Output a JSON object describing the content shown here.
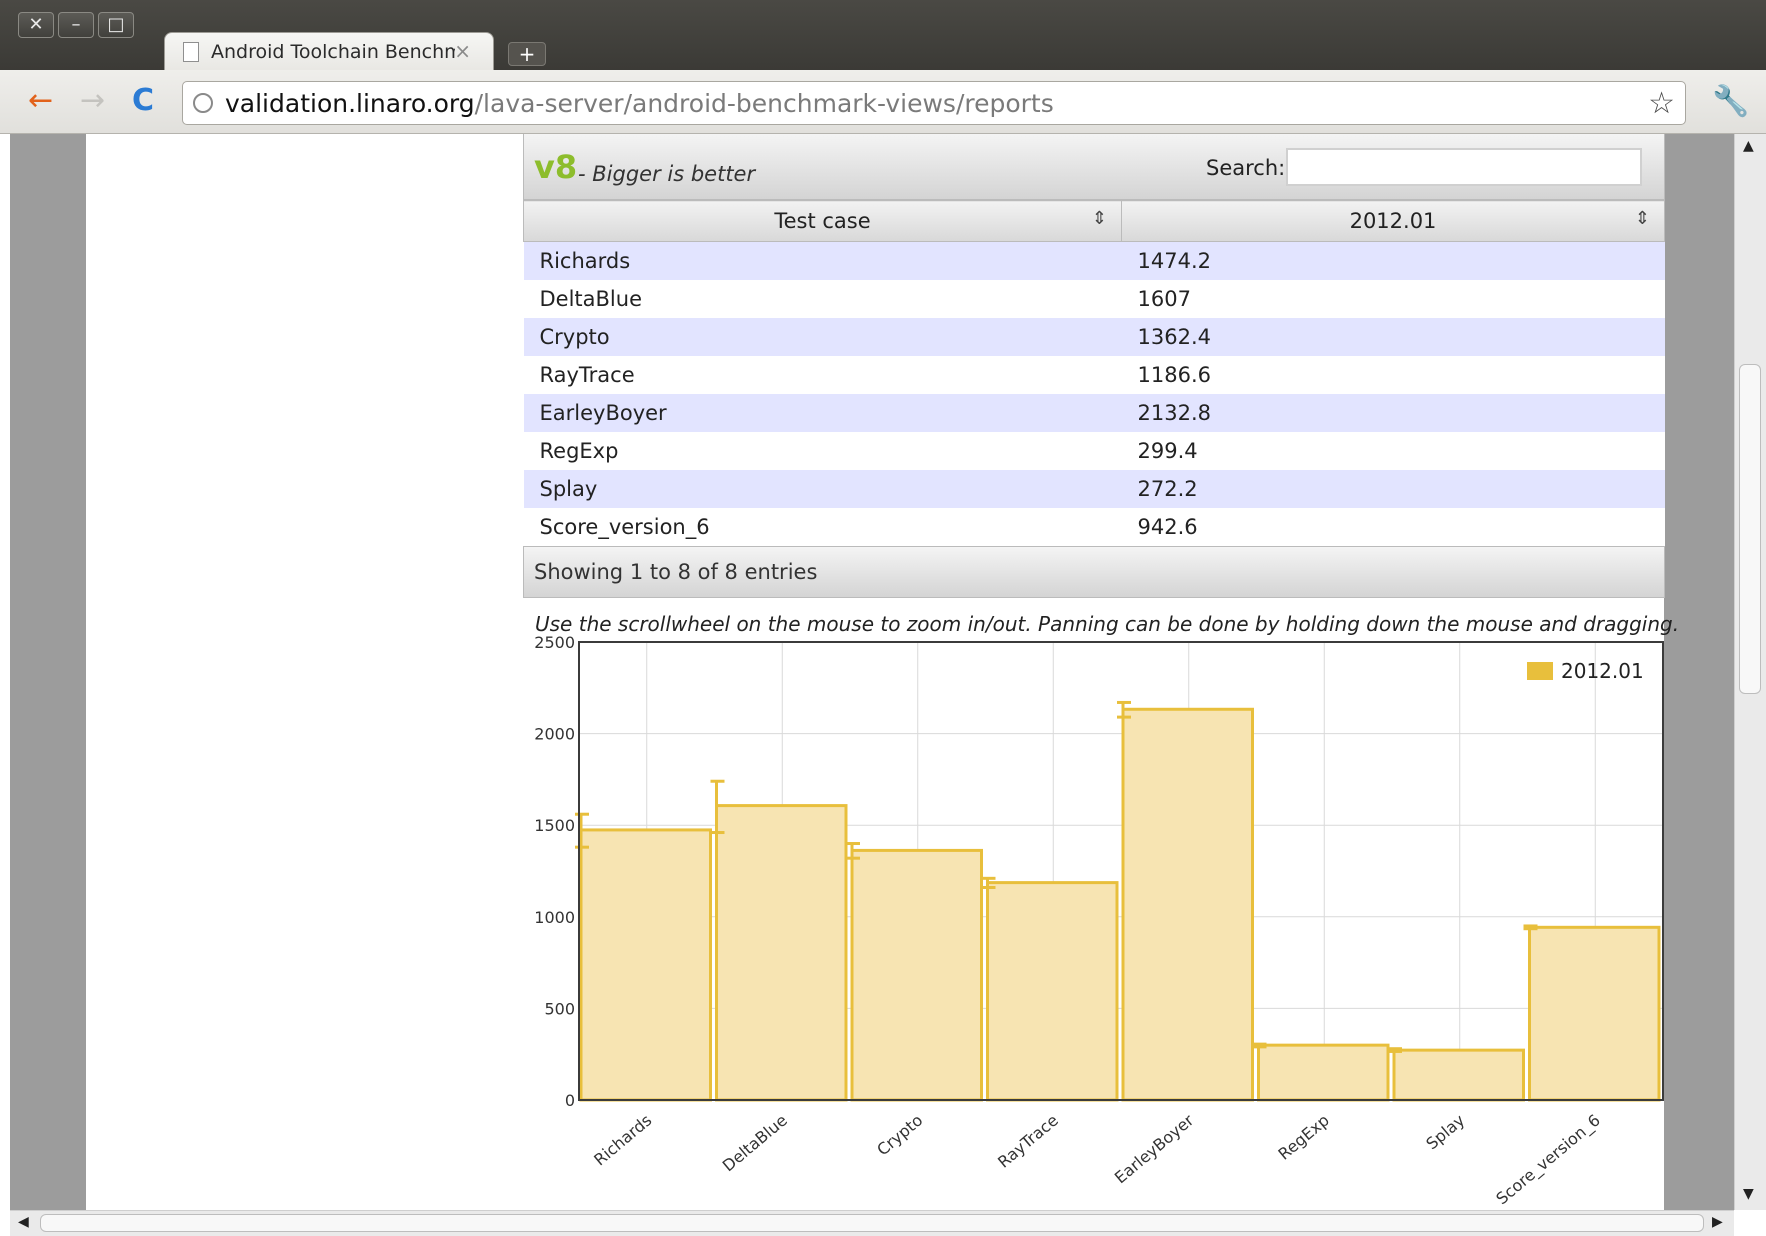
{
  "browser": {
    "tab_title": "Android Toolchain Benchm",
    "tab_close": "×",
    "new_tab": "+",
    "url_host": "validation.linaro.org",
    "url_path": "/lava-server/android-benchmark-views/reports",
    "back_icon": "←",
    "forward_icon": "→",
    "reload_icon": "C",
    "star_icon": "☆",
    "wrench_icon": "🔧",
    "window_close": "✕",
    "window_minimize": "–",
    "window_maximize": "□"
  },
  "benchmark": {
    "name": "v8",
    "subtitle": "- Bigger is better",
    "search_label": "Search:",
    "search_value": "",
    "columns": [
      "Test case",
      "2012.01"
    ],
    "sort_icon": "⇕",
    "rows": [
      [
        "Richards",
        "1474.2"
      ],
      [
        "DeltaBlue",
        "1607"
      ],
      [
        "Crypto",
        "1362.4"
      ],
      [
        "RayTrace",
        "1186.6"
      ],
      [
        "EarleyBoyer",
        "2132.8"
      ],
      [
        "RegExp",
        "299.4"
      ],
      [
        "Splay",
        "272.2"
      ],
      [
        "Score_version_6",
        "942.6"
      ]
    ],
    "footer": "Showing 1 to 8 of 8 entries",
    "hint": "Use the scrollwheel on the mouse to zoom in/out. Panning can be done by holding down the mouse and dragging."
  },
  "chart_data": {
    "type": "bar",
    "categories": [
      "Richards",
      "DeltaBlue",
      "Crypto",
      "RayTrace",
      "EarleyBoyer",
      "RegExp",
      "Splay",
      "Score_version_6"
    ],
    "series": [
      {
        "name": "2012.01",
        "values": [
          1474.2,
          1607,
          1362.4,
          1186.6,
          2132.8,
          299.4,
          272.2,
          942.6
        ],
        "error_low": [
          1380,
          1460,
          1320,
          1160,
          2090,
          290,
          265,
          935
        ],
        "error_high": [
          1560,
          1740,
          1400,
          1210,
          2170,
          305,
          280,
          950
        ]
      }
    ],
    "ylim": [
      0,
      2500
    ],
    "yticks": [
      0,
      500,
      1000,
      1500,
      2000,
      2500
    ],
    "grid": true,
    "legend": "top-right",
    "bar_color": "#e8bf3c",
    "bar_fill": "#f7e4b2"
  }
}
